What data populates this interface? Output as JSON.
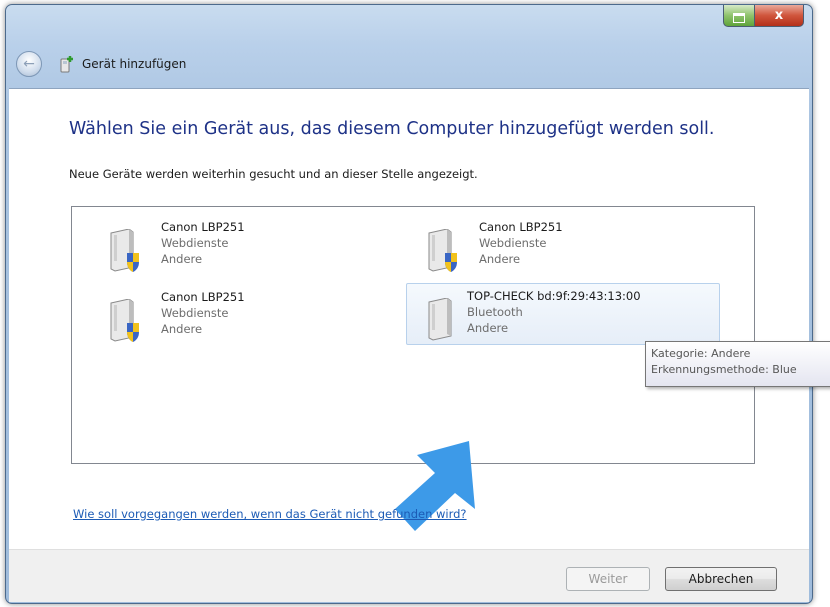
{
  "window": {
    "title": "Gerät hinzufügen",
    "caption_buttons": {
      "minimize": "_",
      "close": "x"
    }
  },
  "main": {
    "heading": "Wählen Sie ein Gerät aus, das diesem Computer hinzugefügt werden soll.",
    "subtext": "Neue Geräte werden weiterhin gesucht und an dieser Stelle angezeigt.",
    "devices": [
      {
        "name": "Canon LBP251",
        "method": "Webdienste",
        "category": "Andere",
        "icon": "printer-shield-icon"
      },
      {
        "name": "Canon LBP251",
        "method": "Webdienste",
        "category": "Andere",
        "icon": "printer-shield-icon"
      },
      {
        "name": "Canon LBP251",
        "method": "Webdienste",
        "category": "Andere",
        "icon": "printer-shield-icon"
      },
      {
        "name": "TOP-CHECK bd:9f:29:43:13:00",
        "method": "Bluetooth",
        "category": "Andere",
        "icon": "device-icon",
        "selected": true
      }
    ],
    "tooltip": {
      "line1": "Kategorie: Andere",
      "line2": "Erkennungsmethode: Blue"
    },
    "help_link": "Wie soll vorgegangen werden, wenn das Gerät nicht gefunden wird?"
  },
  "footer": {
    "next_label": "Weiter",
    "cancel_label": "Abbrechen"
  },
  "colors": {
    "heading": "#1e3287",
    "link": "#1c5bb5",
    "arrow": "#3d9ae8",
    "selection_border": "#b8d1ec"
  }
}
